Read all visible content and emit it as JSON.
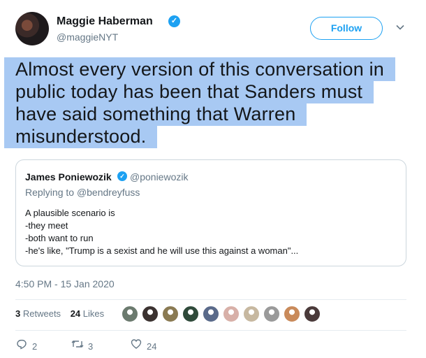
{
  "author": {
    "name": "Maggie Haberman",
    "handle": "@maggieNYT",
    "verified_glyph": "✓"
  },
  "follow_label": "Follow",
  "tweet_lines": [
    "Almost every version of this conversation in",
    "public today has been that Sanders must",
    "have said something that Warren",
    "misunderstood."
  ],
  "highlight_color": "#a8c9f3",
  "quote": {
    "name": "James Poniewozik",
    "handle": "@poniewozik",
    "verified_glyph": "✓",
    "reply_prefix": "Replying to ",
    "reply_to": "@bendreyfuss",
    "lines": [
      "A plausible scenario is",
      "-they meet",
      "-both want to run",
      "-he's like, \"Trump is a sexist and he will use this against a woman\"..."
    ]
  },
  "timestamp": "4:50 PM - 15 Jan 2020",
  "stats": {
    "retweets_count": "3",
    "retweets_label": "Retweets",
    "likes_count": "24",
    "likes_label": "Likes"
  },
  "liker_colors": [
    "#6b7a6e",
    "#3b3230",
    "#8a7a52",
    "#2f4a3a",
    "#5a6a8a",
    "#d8b0a8",
    "#c7b8a0",
    "#9a9a9a",
    "#c98a5a",
    "#4a3a3a"
  ],
  "actions": {
    "reply_count": "2",
    "retweet_count": "3",
    "like_count": "24"
  },
  "colors": {
    "accent": "#1da1f2",
    "secondary_text": "#657786"
  }
}
